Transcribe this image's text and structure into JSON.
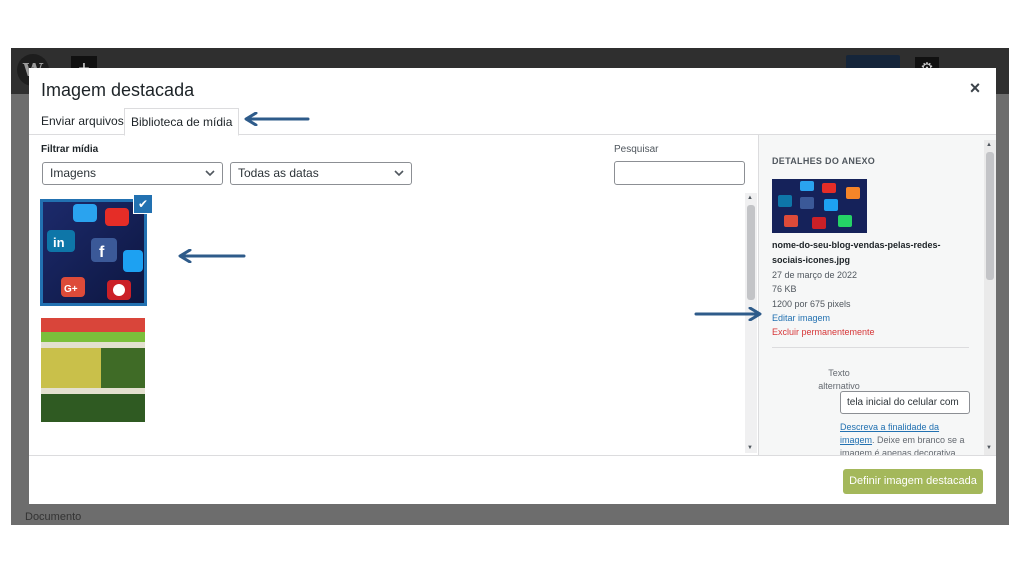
{
  "modal": {
    "title": "Imagem destacada",
    "close_glyph": "×",
    "tabs": [
      {
        "label": "Enviar arquivos"
      },
      {
        "label": "Biblioteca de mídia"
      }
    ]
  },
  "filters": {
    "label": "Filtrar mídia",
    "type_selected": "Imagens",
    "date_selected": "Todas as datas",
    "search_label": "Pesquisar"
  },
  "grid": {
    "items": [
      {
        "name": "social-media-icons-phone",
        "selected": true
      },
      {
        "name": "fruits-vegetables-market",
        "selected": false
      }
    ],
    "check_glyph": "✔"
  },
  "attachment": {
    "heading": "DETALHES DO ANEXO",
    "filename": "nome-do-seu-blog-vendas-pelas-redes-sociais-icones.jpg",
    "date": "27 de março de 2022",
    "size": "76 KB",
    "dimensions": "1200 por 675 pixels",
    "edit_link": "Editar imagem",
    "delete_link": "Excluir permanentemente",
    "alt_label": "Texto alternativo",
    "alt_value": "tela inicial do celular com",
    "help_link": "Descreva a finalidade da imagem",
    "help_text": ". Deixe em branco se a imagem é apenas decorativa."
  },
  "footer": {
    "primary_button": "Definir imagem destacada"
  },
  "editor": {
    "bottom_label": "Documento"
  },
  "colors": {
    "accent": "#2271b1",
    "arrow": "#2e5b8a",
    "primary_button": "#a4b85b",
    "danger": "#d63638"
  },
  "icons": [
    "wordpress-logo",
    "close-icon",
    "chevron-down-icon",
    "checkmark-icon",
    "arrow-left-icon"
  ]
}
